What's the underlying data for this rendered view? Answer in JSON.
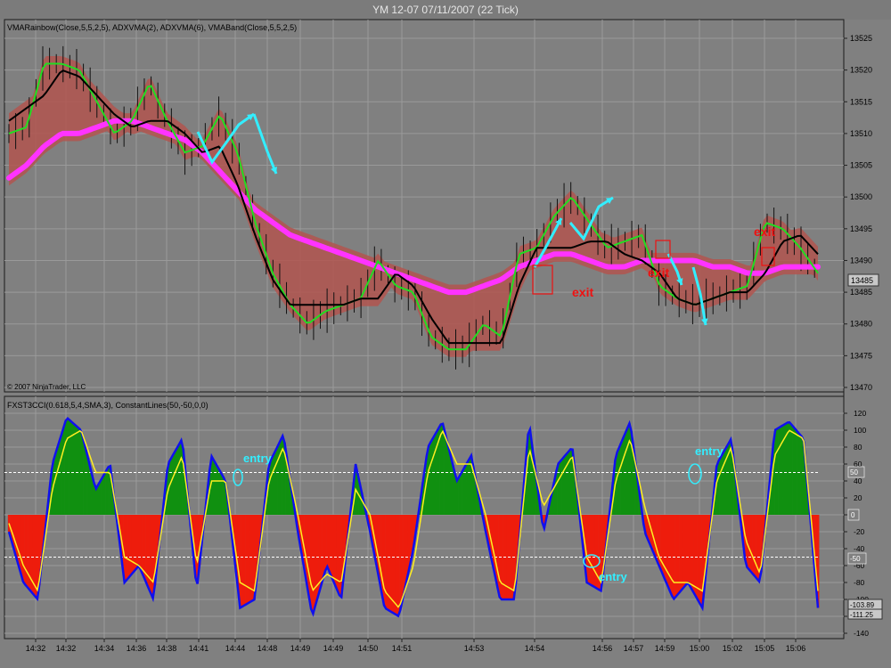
{
  "window": {
    "title": "YM 12-07  07/11/2007  (22 Tick)"
  },
  "colors": {
    "background": "#808080",
    "panel_border": "#1a1a1a",
    "grid": "#9a9a9a",
    "band_fill": "#b2554f",
    "green_line": "#22dd22",
    "black_line": "#000000",
    "magenta_line": "#ff33ff",
    "arrow": "#33eeff",
    "exit_text": "#ee1111",
    "entry_text": "#33eeff",
    "hist_positive": "#109010",
    "hist_negative": "#ee1c0c",
    "cci_line": "#1010ee",
    "signal_line": "#ffee22",
    "constant_line": "#ffffff"
  },
  "price_panel": {
    "label": "VMARainbow(Close,5,5,2,5), ADXVMA(2), ADXVMA(6), VMABand(Close,5,5,2,5)",
    "copyright": "© 2007 NinjaTrader, LLC",
    "last_price": "13485",
    "annotations": [
      {
        "text": "exit",
        "at": "14:54"
      },
      {
        "text": "exit",
        "at": "14:59"
      },
      {
        "text": "exit",
        "at": "15:05"
      }
    ]
  },
  "oscillator_panel": {
    "label": "FXST3CCI(0.618,5,4,SMA,3), ConstantLines(50,-50,0,0)",
    "last_values": [
      "-103.89",
      "-111.25"
    ],
    "annotations": [
      {
        "text": "entry",
        "at": "14:44"
      },
      {
        "text": "entry",
        "at": "14:56"
      },
      {
        "text": "entry",
        "at": "15:00"
      }
    ],
    "constant_tags": [
      "50",
      "0",
      "-50"
    ]
  },
  "chart_data": [
    {
      "type": "line",
      "title": "YM 12-07  07/11/2007  (22 Tick)",
      "x_ticks": [
        "14:32",
        "14:32",
        "14:34",
        "14:36",
        "14:38",
        "14:41",
        "14:44",
        "14:48",
        "14:49",
        "14:49",
        "14:50",
        "14:51",
        "14:53",
        "14:54",
        "14:56",
        "14:57",
        "14:59",
        "15:00",
        "15:02",
        "15:05",
        "15:06"
      ],
      "y_ticks": [
        13470,
        13475,
        13480,
        13485,
        13490,
        13495,
        13500,
        13505,
        13510,
        13515,
        13520,
        13525
      ],
      "ylim": [
        13467,
        13527
      ],
      "grid": true,
      "series": [
        {
          "name": "VMARainbow(Close,5,5,2,5)",
          "values": [
            13510,
            13511,
            13521,
            13521,
            13520,
            13515,
            13510,
            13512,
            13518,
            13512,
            13507,
            13508,
            13513,
            13507,
            13496,
            13488,
            13483,
            13480,
            13482,
            13483,
            13484,
            13490,
            13486,
            13485,
            13478,
            13476,
            13476,
            13480,
            13478,
            13491,
            13492,
            13497,
            13500,
            13496,
            13492,
            13493,
            13494,
            13486,
            13484,
            13483,
            13484,
            13485,
            13486,
            13496,
            13495,
            13492,
            13488
          ]
        },
        {
          "name": "ADXVMA(2)",
          "values": [
            13512,
            13514,
            13516,
            13520,
            13519,
            13516,
            13513,
            13511,
            13512,
            13512,
            13510,
            13507,
            13508,
            13502,
            13494,
            13487,
            13483,
            13483,
            13483,
            13483,
            13484,
            13484,
            13488,
            13486,
            13481,
            13477,
            13477,
            13477,
            13477,
            13486,
            13492,
            13492,
            13492,
            13493,
            13493,
            13491,
            13490,
            13488,
            13484,
            13483,
            13484,
            13485,
            13485,
            13488,
            13493,
            13494,
            13491
          ]
        },
        {
          "name": "ADXVMA(6)",
          "values": [
            13503,
            13505,
            13508,
            13510,
            13510,
            13511,
            13512,
            13512,
            13511,
            13510,
            13509,
            13507,
            13504,
            13501,
            13498,
            13496,
            13494,
            13493,
            13492,
            13491,
            13490,
            13489,
            13488,
            13487,
            13486,
            13485,
            13485,
            13486,
            13487,
            13489,
            13490,
            13491,
            13491,
            13490,
            13489,
            13489,
            13490,
            13490,
            13490,
            13490,
            13489,
            13489,
            13488,
            13488,
            13489,
            13489,
            13489
          ]
        }
      ]
    },
    {
      "type": "line",
      "title": "FXST3CCI(0.618,5,4,SMA,3), ConstantLines(50,-50,0,0)",
      "x_ticks": [
        "14:32",
        "14:32",
        "14:34",
        "14:36",
        "14:38",
        "14:41",
        "14:44",
        "14:48",
        "14:49",
        "14:49",
        "14:50",
        "14:51",
        "14:53",
        "14:54",
        "14:56",
        "14:57",
        "14:59",
        "15:00",
        "15:02",
        "15:05",
        "15:06"
      ],
      "y_ticks": [
        -140,
        -120,
        -100,
        -80,
        -60,
        -40,
        -20,
        0,
        20,
        40,
        60,
        80,
        100,
        120
      ],
      "ylim": [
        -140,
        125
      ],
      "grid": true,
      "constant_lines": [
        50,
        -50,
        0
      ],
      "series": [
        {
          "name": "FXST3CCI",
          "values": [
            -20,
            -80,
            -100,
            60,
            115,
            100,
            30,
            60,
            -80,
            -60,
            -100,
            60,
            90,
            -90,
            70,
            40,
            -110,
            -100,
            60,
            95,
            -20,
            -120,
            -60,
            -100,
            60,
            -20,
            -110,
            -120,
            -40,
            80,
            110,
            40,
            70,
            -20,
            -100,
            -100,
            110,
            -20,
            60,
            80,
            -80,
            -90,
            70,
            110,
            -20,
            -60,
            -100,
            -80,
            -110,
            60,
            90,
            -60,
            -80,
            100,
            110,
            90,
            -110
          ]
        },
        {
          "name": "Signal",
          "values": [
            -10,
            -60,
            -90,
            30,
            90,
            100,
            50,
            50,
            -50,
            -60,
            -80,
            30,
            70,
            -60,
            40,
            40,
            -80,
            -90,
            40,
            80,
            0,
            -90,
            -70,
            -80,
            30,
            0,
            -90,
            -110,
            -60,
            50,
            100,
            60,
            60,
            0,
            -80,
            -90,
            80,
            10,
            40,
            70,
            -50,
            -80,
            40,
            90,
            10,
            -50,
            -80,
            -80,
            -90,
            40,
            80,
            -30,
            -70,
            70,
            100,
            90,
            -90
          ]
        }
      ]
    }
  ]
}
